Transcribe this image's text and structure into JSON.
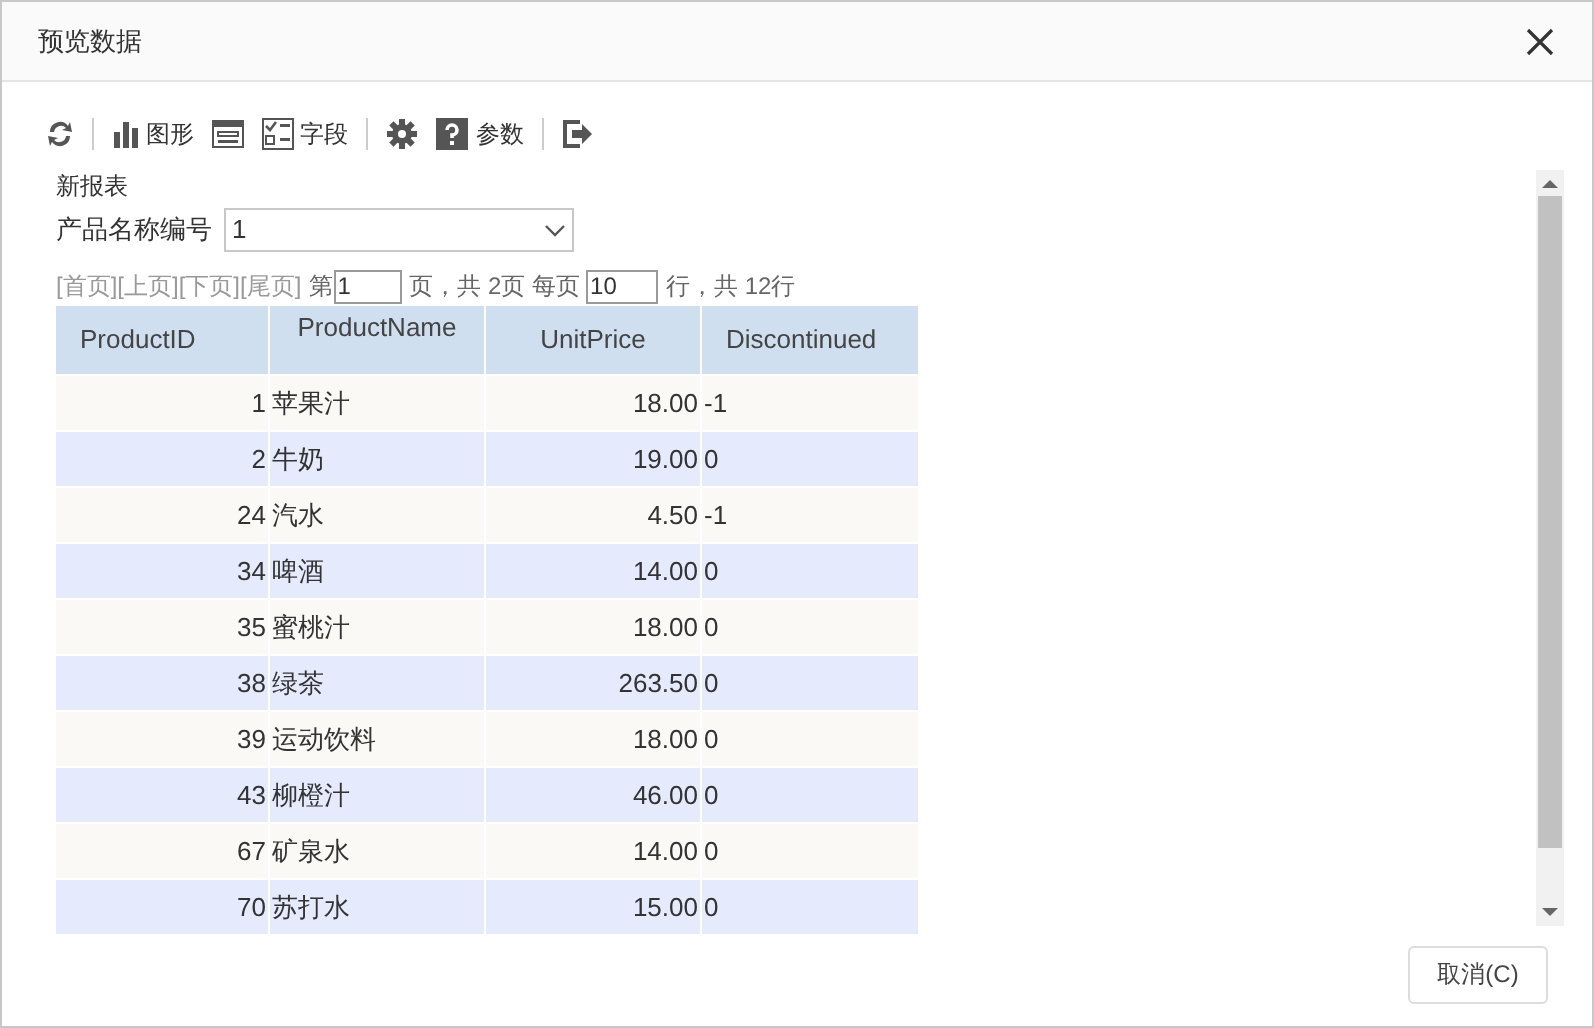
{
  "window": {
    "title": "预览数据"
  },
  "toolbar": [
    {
      "kind": "refresh"
    },
    {
      "kind": "separator"
    },
    {
      "kind": "chart",
      "label": "图形"
    },
    {
      "kind": "layout"
    },
    {
      "kind": "fields",
      "label": "字段"
    },
    {
      "kind": "separator"
    },
    {
      "kind": "settings"
    },
    {
      "kind": "help",
      "label": "参数"
    },
    {
      "kind": "separator"
    },
    {
      "kind": "exit"
    }
  ],
  "report_title": "新报表",
  "parameter": {
    "label": "产品名称编号",
    "value": "1"
  },
  "pager": {
    "links": [
      "[首页]",
      "[上页]",
      "[下页]",
      "[尾页]"
    ],
    "page_prefix": "第",
    "page": "1",
    "page_suffix": "页，共 2页 每页",
    "rows_per_page": "10",
    "rows_suffix": "行，共 12行"
  },
  "table": {
    "columns": [
      "ProductID",
      "ProductName",
      "UnitPrice",
      "Discontinued"
    ],
    "rows": [
      [
        "1",
        "苹果汁",
        "18.00",
        "-1"
      ],
      [
        "2",
        "牛奶",
        "19.00",
        "0"
      ],
      [
        "24",
        "汽水",
        "4.50",
        "-1"
      ],
      [
        "34",
        "啤酒",
        "14.00",
        "0"
      ],
      [
        "35",
        "蜜桃汁",
        "18.00",
        "0"
      ],
      [
        "38",
        "绿茶",
        "263.50",
        "0"
      ],
      [
        "39",
        "运动饮料",
        "18.00",
        "0"
      ],
      [
        "43",
        "柳橙汁",
        "46.00",
        "0"
      ],
      [
        "67",
        "矿泉水",
        "14.00",
        "0"
      ],
      [
        "70",
        "苏打水",
        "15.00",
        "0"
      ]
    ]
  },
  "buttons": [
    {
      "label": "取消(C)"
    }
  ]
}
